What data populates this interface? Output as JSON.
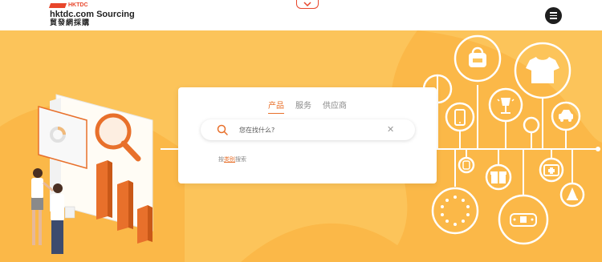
{
  "header": {
    "logo_small": "HKTDC",
    "logo_title": "hktdc.com Sourcing",
    "logo_subtitle": "貿發網採購"
  },
  "search": {
    "tabs": [
      {
        "label": "产品",
        "active": true
      },
      {
        "label": "服务",
        "active": false
      },
      {
        "label": "供应商",
        "active": false
      }
    ],
    "placeholder": "您在找什么?",
    "category_prefix": "按",
    "category_link": "类别",
    "category_suffix": "搜索"
  },
  "icons": [
    "chevron-down-icon",
    "menu-icon",
    "search-icon",
    "close-icon",
    "backpack-icon",
    "tshirt-icon",
    "phone-icon",
    "lamp-icon",
    "car-icon",
    "watch-icon",
    "gift-icon",
    "first-aid-icon",
    "bell-icon",
    "necklace-icon",
    "game-controller-icon"
  ],
  "colors": {
    "accent": "#e8702b",
    "brand_red": "#e8462b",
    "hero_bg": "#fcc45a",
    "hero_shape": "#fbb848"
  }
}
